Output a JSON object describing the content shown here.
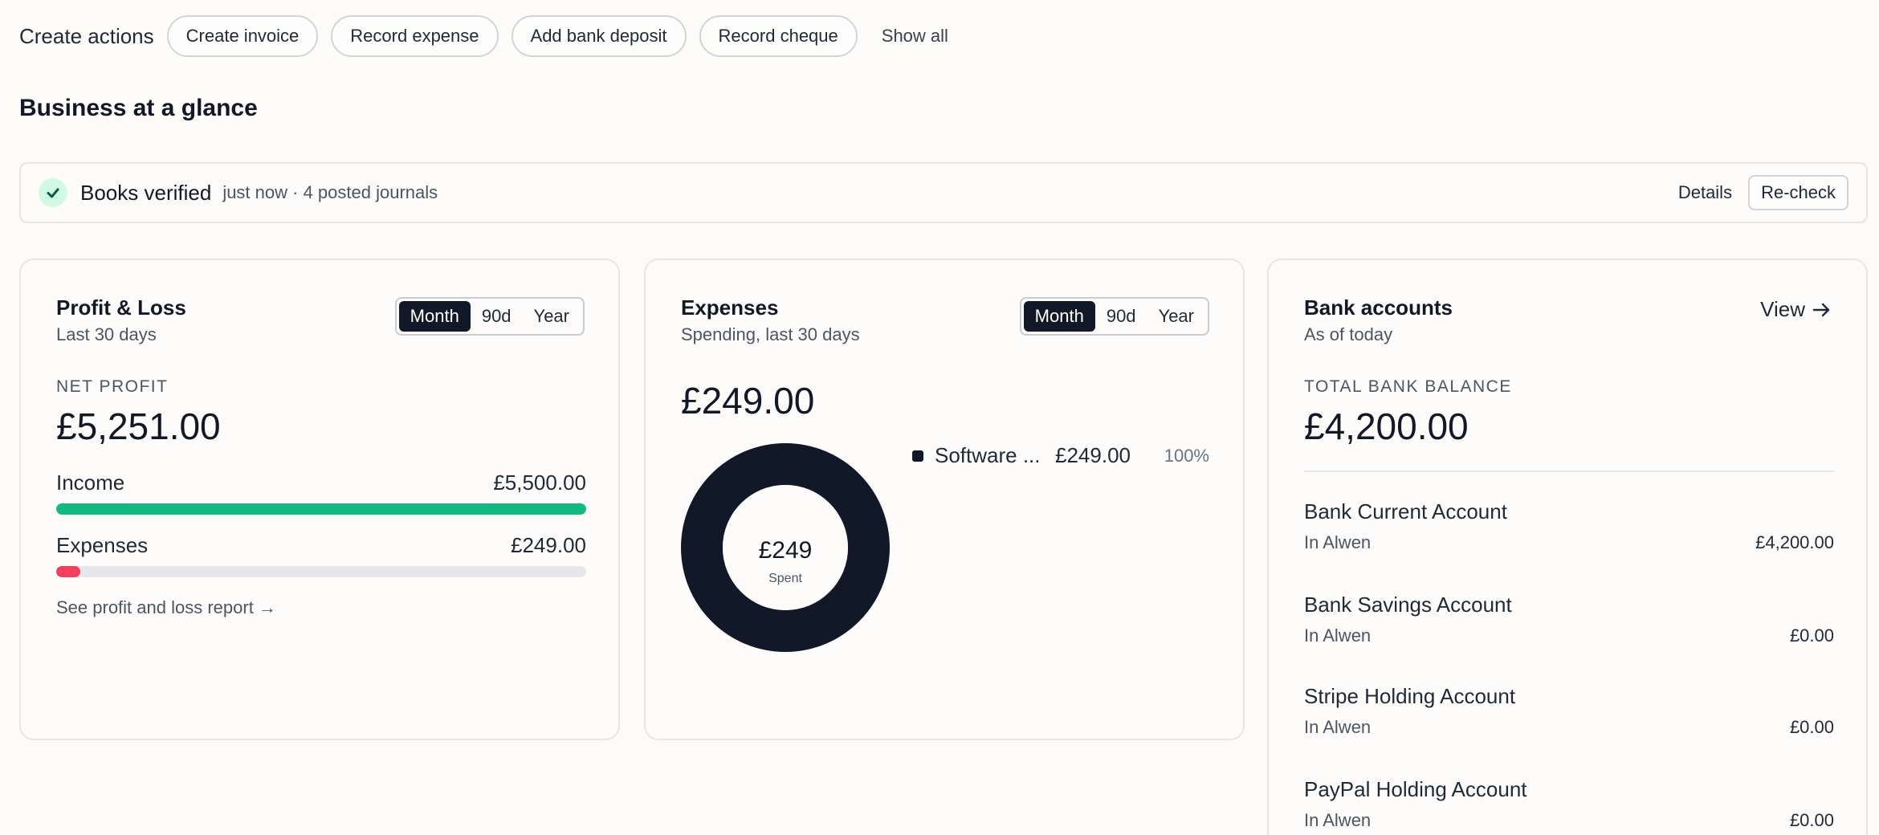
{
  "create_actions": {
    "label": "Create actions",
    "buttons": [
      "Create invoice",
      "Record expense",
      "Add bank deposit",
      "Record cheque"
    ],
    "show_all": "Show all"
  },
  "section_title": "Business at a glance",
  "verification": {
    "title": "Books verified",
    "subtitle": "just now · 4 posted journals",
    "details": "Details",
    "recheck": "Re-check",
    "status_color": "#065f46"
  },
  "profit_loss": {
    "title": "Profit & Loss",
    "subtitle": "Last 30 days",
    "periods": [
      "Month",
      "90d",
      "Year"
    ],
    "active_period": "Month",
    "kicker": "NET PROFIT",
    "net_profit": "£5,251.00",
    "income_label": "Income",
    "income_value": "£5,500.00",
    "income_fraction": 1.0,
    "income_color": "#10b981",
    "expenses_label": "Expenses",
    "expenses_value": "£249.00",
    "expenses_fraction": 0.04527,
    "expenses_color": "#f43f5e",
    "report_link": "See profit and loss report →"
  },
  "expenses": {
    "title": "Expenses",
    "subtitle": "Spending, last 30 days",
    "periods": [
      "Month",
      "90d",
      "Year"
    ],
    "active_period": "Month",
    "total": "£249.00",
    "donut_center": "£249",
    "donut_caption": "Spent",
    "legend": [
      {
        "name": "Software ...",
        "amount": "£249.00",
        "percent": "100%",
        "share": 1.0,
        "color": "#111827"
      }
    ]
  },
  "bank": {
    "title": "Bank accounts",
    "subtitle": "As of today",
    "view": "View",
    "kicker": "TOTAL BANK BALANCE",
    "total": "£4,200.00",
    "accounts": [
      {
        "name": "Bank Current Account",
        "org": "In Alwen",
        "amount": "£4,200.00"
      },
      {
        "name": "Bank Savings Account",
        "org": "In Alwen",
        "amount": "£0.00"
      },
      {
        "name": "Stripe Holding Account",
        "org": "In Alwen",
        "amount": "£0.00"
      },
      {
        "name": "PayPal Holding Account",
        "org": "In Alwen",
        "amount": "£0.00"
      }
    ]
  }
}
